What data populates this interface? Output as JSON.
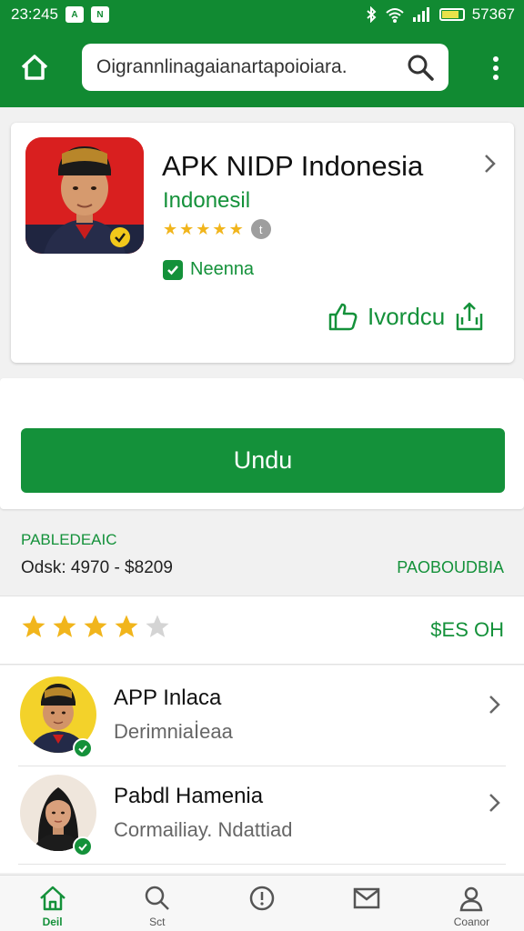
{
  "status_bar": {
    "time": "23:245",
    "right_text": "57367",
    "left_badges": [
      "A",
      "N"
    ]
  },
  "header": {
    "search_value": "Oigrannlinagaianartapoioiara."
  },
  "app_card": {
    "title": "APK NIDP Indonesia",
    "subtitle": "Indonesil",
    "rating_stars": 5,
    "info_badge": "t",
    "verified_label": "Neenna",
    "action_label": "Ivordcu"
  },
  "download": {
    "button_label": "Undu"
  },
  "info": {
    "heading": "PABLEDEAIC",
    "detail": "Odsk: 4970 - $8209",
    "right_label": "PAOBOUDBIA"
  },
  "rating": {
    "value": 4,
    "max": 5,
    "label": "$ES OH"
  },
  "list": {
    "items": [
      {
        "title": "APP Inlaca",
        "subtitle": "Derimniaİeaa"
      },
      {
        "title": "Pabdl Hamenia",
        "subtitle": "Cormailiay. Ndattiad"
      }
    ]
  },
  "bottom_nav": {
    "items": [
      {
        "label": "Deil",
        "icon": "home-icon"
      },
      {
        "label": "Sct",
        "icon": "search-icon"
      },
      {
        "label": "",
        "icon": "info-icon"
      },
      {
        "label": "",
        "icon": "mail-icon"
      },
      {
        "label": "Coanor",
        "icon": "profile-icon"
      }
    ]
  },
  "colors": {
    "brand_green": "#14913a",
    "header_green": "#118a32",
    "star_gold": "#f1b51c",
    "icon_red": "#d91f1f"
  }
}
